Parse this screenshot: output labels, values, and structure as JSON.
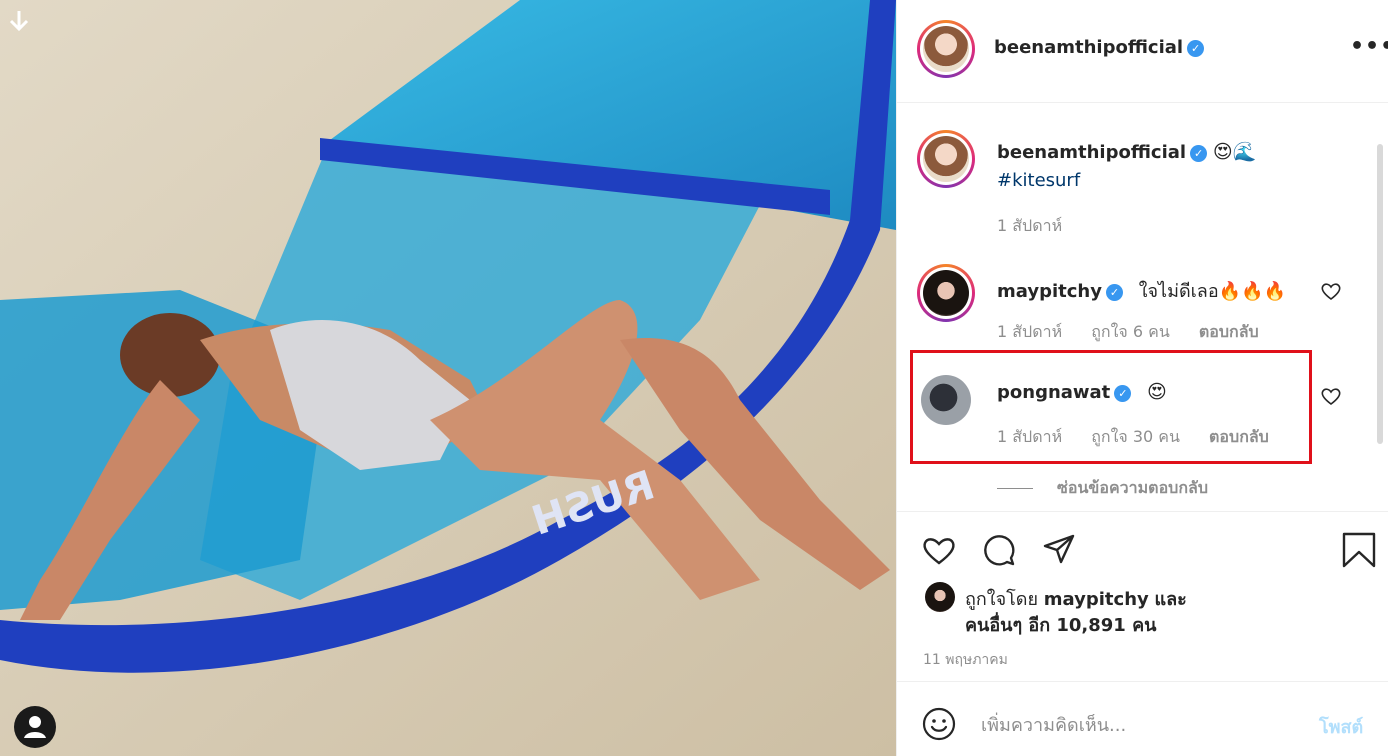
{
  "post": {
    "owner": "beenamthipofficial",
    "more_icon": "more-options-icon",
    "caption": {
      "emoji": "😍🌊",
      "hashtag": "#kitesurf",
      "time": "1 สัปดาห์"
    },
    "photo": {
      "download_icon": "arrow-down-icon",
      "tag_icon": "user-tag-icon",
      "kite_brand": "RUSH"
    }
  },
  "comments": [
    {
      "username": "maypitchy",
      "text": "ใจไม่ดีเลอ🔥🔥🔥",
      "time": "1 สัปดาห์",
      "likes": "ถูกใจ 6 คน",
      "reply": "ตอบกลับ"
    },
    {
      "username": "pongnawat",
      "text": "😍",
      "time": "1 สัปดาห์",
      "likes": "ถูกใจ 30 คน",
      "reply": "ตอบกลับ"
    }
  ],
  "hide_replies": "ซ่อนข้อความตอบกลับ",
  "actions": {
    "like_icon": "heart-icon",
    "comment_icon": "comment-icon",
    "share_icon": "send-icon",
    "save_icon": "bookmark-icon"
  },
  "likes_summary": {
    "prefix": "ถูกใจโดย",
    "user": "maypitchy",
    "and": "และ",
    "others": "คนอื่นๆ อีก 10,891 คน"
  },
  "date": "11 พฤษภาคม",
  "composer": {
    "placeholder": "เพิ่มความคิดเห็น...",
    "post_label": "โพสต์"
  },
  "colors": {
    "verified": "#3897f0",
    "highlight_box": "#e0101a",
    "post_button_disabled": "#b2dffc"
  }
}
